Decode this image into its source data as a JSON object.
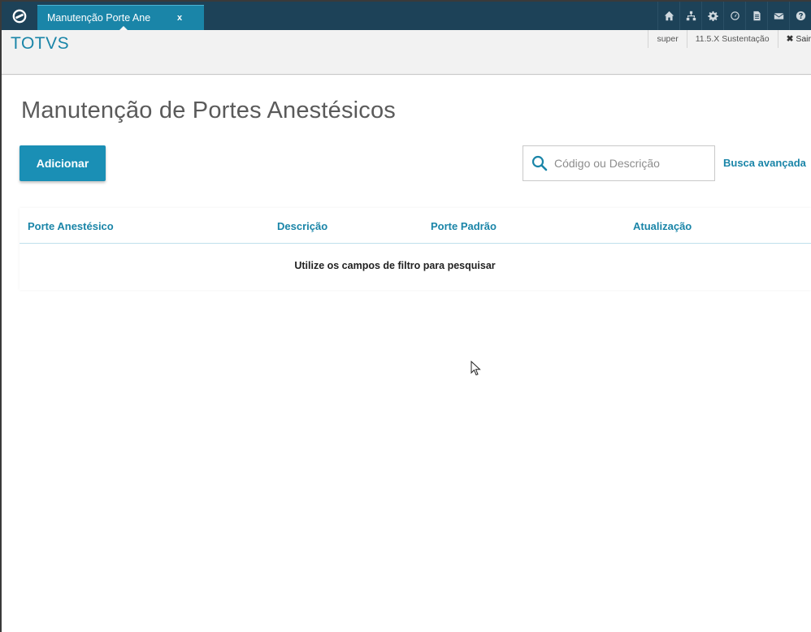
{
  "app": {
    "tab_label": "Manutenção Porte Ane",
    "tab_close": "x",
    "brand": "TOTVS",
    "user": "super",
    "environment": "11.5.X Sustentação",
    "logout_label": "Sair",
    "top_icons": [
      "home-icon",
      "sitemap-icon",
      "gear-icon",
      "dashboard-icon",
      "document-icon",
      "mail-icon",
      "help-icon"
    ]
  },
  "page": {
    "title": "Manutenção de Portes Anestésicos",
    "add_label": "Adicionar",
    "search_placeholder": "Código ou Descrição",
    "advanced_search": "Busca avançada"
  },
  "table": {
    "columns": [
      "Porte Anestésico",
      "Descrição",
      "Porte Padrão",
      "Atualização"
    ],
    "empty_message": "Utilize os campos de filtro para pesquisar"
  },
  "colors": {
    "topbar": "#1d4258",
    "accent": "#1a85a8",
    "button": "#1a8fb5"
  }
}
